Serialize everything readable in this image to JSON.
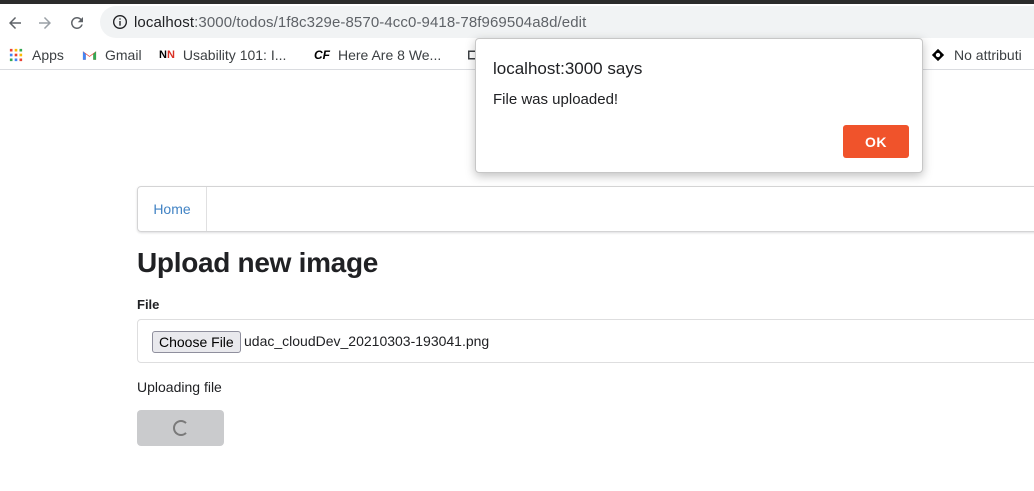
{
  "browser": {
    "url_host": "localhost",
    "url_path": ":3000/todos/1f8c329e-8570-4cc0-9418-78f969504a8d/edit",
    "bookmarks": [
      {
        "label": "Apps",
        "icon": "apps-grid-icon"
      },
      {
        "label": "Gmail",
        "icon": "gmail-icon"
      },
      {
        "label": "Usability 101: I...",
        "icon": "nn-icon"
      },
      {
        "label": "Here Are 8 We...",
        "icon": "cf-icon"
      },
      {
        "label": "No attributi",
        "icon": "bookmark-icon"
      }
    ]
  },
  "page": {
    "menu_home": "Home",
    "title": "Upload new image",
    "file_label": "File",
    "choose_file_label": "Choose File",
    "file_name": "udac_cloudDev_20210303-193041.png",
    "status_text": "Uploading file"
  },
  "dialog": {
    "title": "localhost:3000 says",
    "message": "File was uploaded!",
    "ok_label": "OK"
  },
  "colors": {
    "accent_ok": "#f0532b",
    "link": "#4183c4"
  }
}
